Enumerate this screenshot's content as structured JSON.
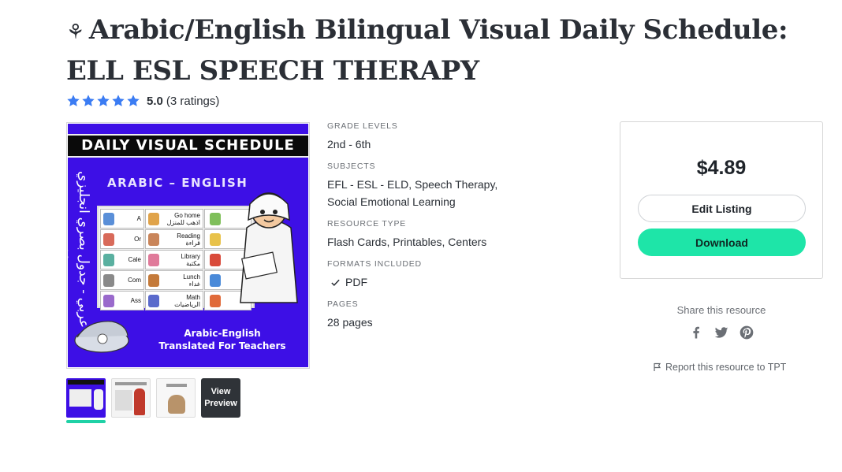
{
  "product": {
    "title_icon": "⚘",
    "title": "Arabic/English Bilingual Visual Daily Schedule: ELL ESL SPEECH THERAPY",
    "rating_value": "5.0",
    "rating_count": "(3 ratings)",
    "rating_stars": 5,
    "star_color": "#3b7cf3"
  },
  "cover": {
    "banner": "DAILY VISUAL SCHEDULE",
    "subtitle": "ARABIC – ENGLISH",
    "side_arabic": "عربي - جدول بصري انجليزي يومي",
    "cells": [
      "A",
      "Go home\nاذهب للمنزل",
      "",
      "Or",
      "Reading\nقراءة",
      "",
      "Cale",
      "Library\nمكتبة",
      "",
      "Com",
      "Lunch\nغداء",
      "",
      "Ass",
      "Math\nالرياضيات",
      ""
    ],
    "footer_line1": "Arabic-English",
    "footer_line2": "Translated For Teachers",
    "background": "#3d0fe6"
  },
  "thumbnails": {
    "view_line1": "View",
    "view_line2": "Preview",
    "active_color": "#1fd1a6"
  },
  "details": {
    "grade_levels_label": "GRADE LEVELS",
    "grade_levels": "2nd - 6th",
    "subjects_label": "SUBJECTS",
    "subjects_line1": "EFL - ESL - ELD, Speech Therapy,",
    "subjects_line2": "Social Emotional Learning",
    "resource_type_label": "RESOURCE TYPE",
    "resource_type": "Flash Cards, Printables, Centers",
    "formats_label": "FORMATS INCLUDED",
    "format_pdf": "PDF",
    "pages_label": "PAGES",
    "pages": "28 pages"
  },
  "purchase": {
    "price": "$4.89",
    "edit_label": "Edit Listing",
    "download_label": "Download",
    "download_color": "#1ee5a8"
  },
  "share": {
    "label": "Share this resource",
    "icons": [
      "facebook-icon",
      "twitter-icon",
      "pinterest-icon"
    ],
    "report_label": "Report this resource to TPT"
  }
}
